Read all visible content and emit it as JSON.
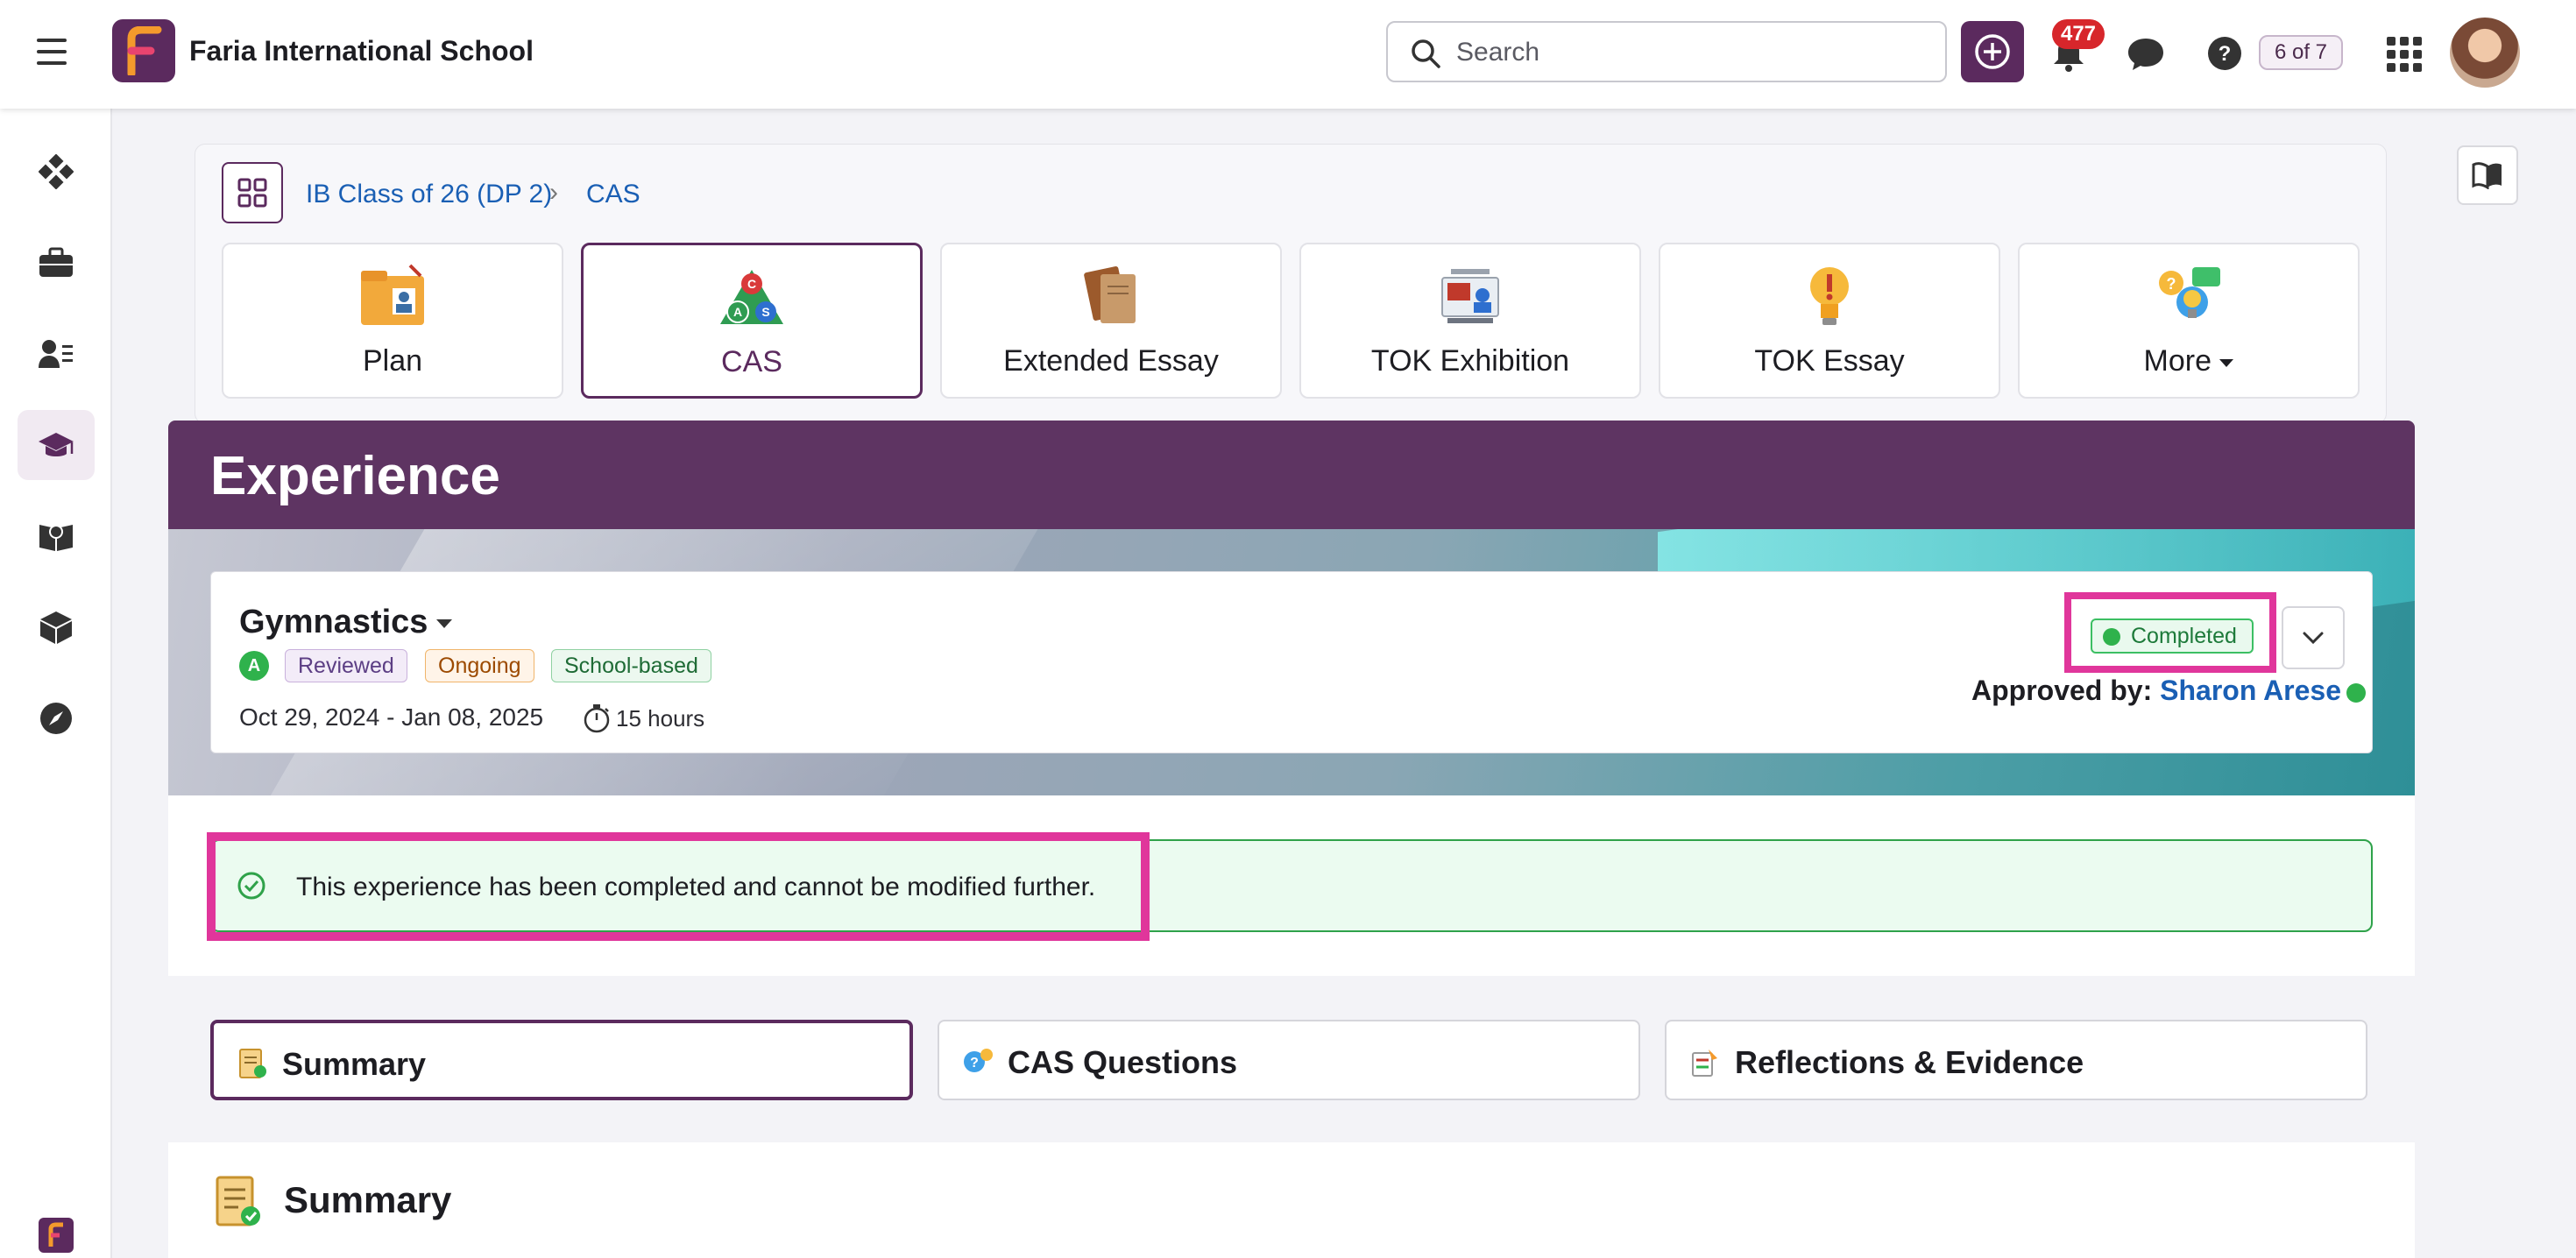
{
  "header": {
    "school_name": "Faria International School",
    "search_placeholder": "Search",
    "notification_count": "477",
    "page_counter": "6 of 7"
  },
  "leftrail": {
    "items": [
      {
        "icon": "dashboard-icon"
      },
      {
        "icon": "briefcase-icon"
      },
      {
        "icon": "people-icon"
      },
      {
        "icon": "graduation-cap-icon",
        "active": true
      },
      {
        "icon": "globe-book-icon"
      },
      {
        "icon": "cube-icon"
      },
      {
        "icon": "compass-icon"
      }
    ]
  },
  "breadcrumb": {
    "items": [
      "IB Class of 26 (DP 2)",
      "CAS"
    ]
  },
  "programme_tiles": [
    {
      "label": "Plan",
      "icon": "plan-folder-icon"
    },
    {
      "label": "CAS",
      "icon": "cas-triangle-icon",
      "active": true
    },
    {
      "label": "Extended Essay",
      "icon": "essay-books-icon"
    },
    {
      "label": "TOK Exhibition",
      "icon": "exhibition-icon"
    },
    {
      "label": "TOK Essay",
      "icon": "lightbulb-icon"
    },
    {
      "label": "More",
      "icon": "ideas-icon"
    }
  ],
  "experience": {
    "page_title": "Experience",
    "name": "Gymnastics",
    "letter_badge": "A",
    "tags": [
      "Reviewed",
      "Ongoing",
      "School-based"
    ],
    "dates": "Oct 29, 2024 - Jan 08, 2025",
    "hours": "15 hours",
    "status": "Completed",
    "approved_label": "Approved by:",
    "approved_by": "Sharon Arese"
  },
  "notice": {
    "text": "This experience has been completed and cannot be modified further."
  },
  "tabs": [
    {
      "label": "Summary",
      "active": true
    },
    {
      "label": "CAS Questions"
    },
    {
      "label": "Reflections & Evidence"
    }
  ],
  "summary": {
    "title": "Summary"
  },
  "colors": {
    "brand": "#5b2a5e",
    "link": "#1a5fb4",
    "success": "#2fb24c",
    "highlight": "#e0369b"
  }
}
